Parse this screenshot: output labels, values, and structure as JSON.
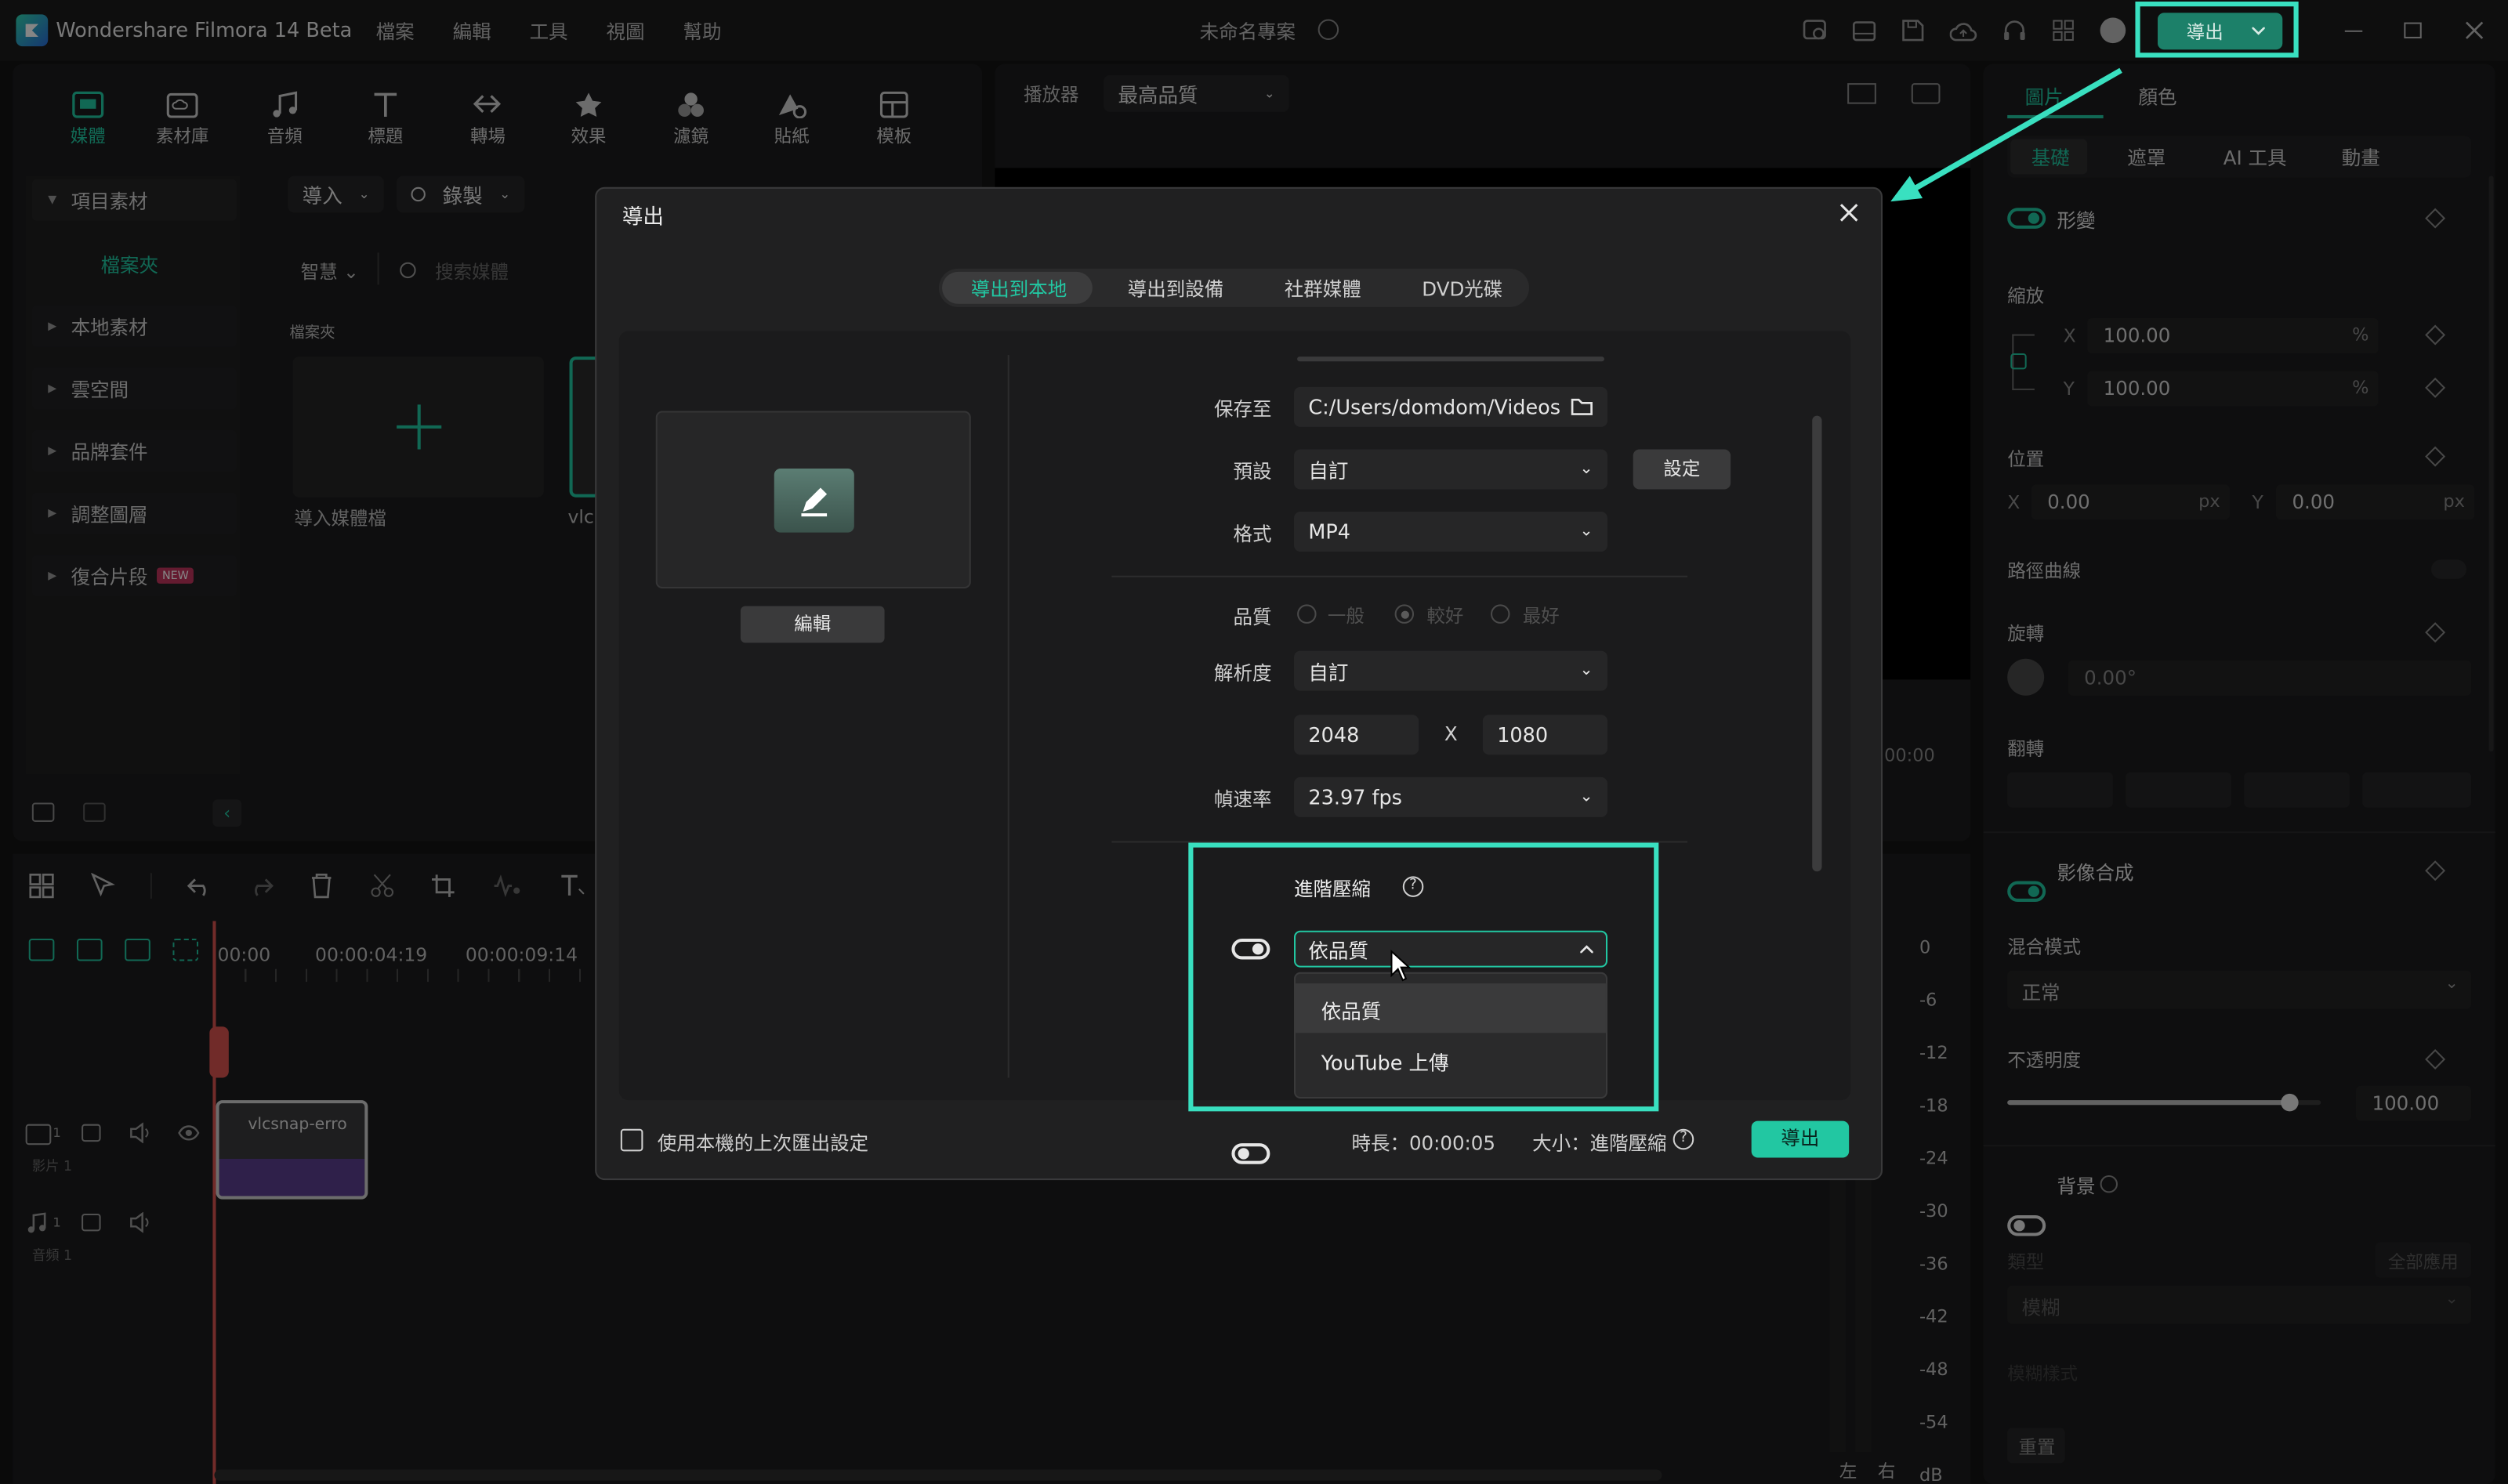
{
  "app": {
    "title": "Wondershare Filmora 14 Beta",
    "project": "未命名專案",
    "menus": [
      "檔案",
      "編輯",
      "工具",
      "視圖",
      "幫助"
    ],
    "export_btn": "導出"
  },
  "toolbar": {
    "tabs": [
      "媒體",
      "素材庫",
      "音頻",
      "標題",
      "轉場",
      "效果",
      "濾鏡",
      "貼紙",
      "模板"
    ]
  },
  "media": {
    "tree": [
      "項目素材",
      "檔案夾",
      "本地素材",
      "雲空間",
      "品牌套件",
      "調整圖層",
      "復合片段"
    ],
    "new_badge": "NEW",
    "import": "導入",
    "record": "錄製",
    "smart": "智慧",
    "search_ph": "搜索媒體",
    "folder_label": "檔案夾",
    "import_media": "導入媒體檔",
    "clip_name": "vlc"
  },
  "preview": {
    "player": "播放器",
    "quality": "最高品質"
  },
  "timeline": {
    "t0": "00:00",
    "t1": "00:00:04:19",
    "t2": "00:00:09:14",
    "video_track": "影片 1",
    "audio_track": "音頻 1",
    "clip": "vlcsnap-erro",
    "track_num": "1",
    "meter_labels": [
      "0",
      "-6",
      "-12",
      "-18",
      "-24",
      "-30",
      "-36",
      "-42",
      "-48",
      "-54",
      "dB"
    ],
    "lr": [
      "左",
      "右"
    ],
    "time_right": "00:00"
  },
  "right": {
    "tabs": [
      "圖片",
      "顏色"
    ],
    "subtabs": [
      "基礎",
      "遮罩",
      "AI 工具",
      "動畫"
    ],
    "transform": "形變",
    "scale": "縮放",
    "x": "X",
    "y": "Y",
    "scale_x": "100.00",
    "scale_y": "100.00",
    "pct": "%",
    "position": "位置",
    "pos_x": "0.00",
    "pos_y": "0.00",
    "px": "px",
    "path_curve": "路徑曲線",
    "rotate": "旋轉",
    "rotate_val": "0.00°",
    "flip": "翻轉",
    "blend": "影像合成",
    "blend_mode": "混合模式",
    "blend_mode_val": "正常",
    "opacity": "不透明度",
    "opacity_val": "100.00",
    "opacity_level": 0.9,
    "background": "背景",
    "type": "類型",
    "apply_all": "全部應用",
    "blur": "模糊",
    "blur_style": "模糊樣式",
    "reset": "重置"
  },
  "dialog": {
    "title": "導出",
    "tabs": [
      "導出到本地",
      "導出到設備",
      "社群媒體",
      "DVD光碟"
    ],
    "edit_btn": "編輯",
    "save_label": "保存至",
    "save_path": "C:/Users/domdom/Videos",
    "preset_label": "預設",
    "preset_val": "自訂",
    "settings_btn": "設定",
    "format_label": "格式",
    "format_val": "MP4",
    "quality_label": "品質",
    "quality_opts": [
      "一般",
      "較好",
      "最好"
    ],
    "resolution_label": "解析度",
    "resolution_val": "自訂",
    "width": "2048",
    "x": "X",
    "height": "1080",
    "fps_label": "幀速率",
    "fps_val": "23.97 fps",
    "adv_label": "進階壓縮",
    "adv_select": "依品質",
    "dropdown_opts": [
      "依品質",
      "YouTube 上傳"
    ],
    "remember": "使用本機的上次匯出設定",
    "duration": "時長：00:00:05",
    "size": "大小：進階壓縮",
    "export_btn": "導出"
  },
  "colors": {
    "accent": "#22c7a2",
    "highlight": "#39e0c0",
    "bg": "#141414",
    "dialog": "#202021"
  }
}
